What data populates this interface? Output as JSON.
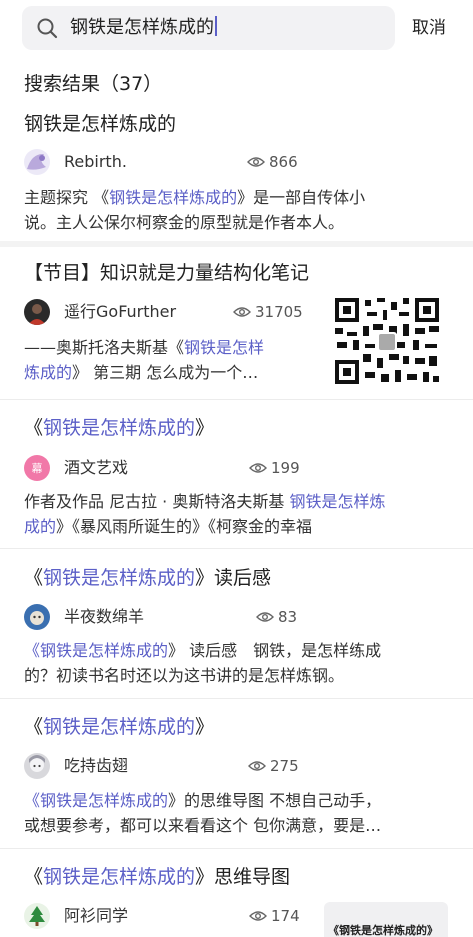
{
  "search": {
    "query": "钢铁是怎样炼成的",
    "cancel_label": "取消"
  },
  "results_heading": "搜索结果（37）",
  "results": [
    {
      "title_hl": "钢铁是怎样炼成的",
      "author": "Rebirth.",
      "views": "866",
      "snippet_line1_pre": "主题探究 《",
      "snippet_line1_hl": "钢铁是怎样炼成的",
      "snippet_line1_post": "》是一部自传体小",
      "snippet_line2": "说。主人公保尔柯察金的原型就是作者本人。"
    },
    {
      "title": "【节目】知识就是力量结构化笔记",
      "author": "遥行GoFurther",
      "views": "31705",
      "snippet_line1_pre": "——奥斯托洛夫斯基《",
      "snippet_line1_hl": "钢铁是怎样",
      "snippet_line2_hl": "炼成的",
      "snippet_line2_post": "》 第三期 怎么成为一个…"
    },
    {
      "title_open": "《",
      "title_hl": "钢铁是怎样炼成的",
      "title_close": "》",
      "author": "酒文艺戏",
      "avatar_text": "幕",
      "views": "199",
      "snippet_line1_pre": "作者及作品 尼古拉 · 奥斯特洛夫斯基 ",
      "snippet_line1_hl": "钢铁是怎样炼",
      "snippet_line2_hl": "成的",
      "snippet_line2_post": "》《暴风雨所诞生的》《柯察金的幸福"
    },
    {
      "title_open": "《",
      "title_hl": "钢铁是怎样炼成的",
      "title_close": "》读后感",
      "author": "半夜数绵羊",
      "views": "83",
      "snippet_line1_open": "《",
      "snippet_line1_hl": "钢铁是怎样炼成的",
      "snippet_line1_post": "》 读后感　钢铁，是怎样练成",
      "snippet_line2": "的？初读书名时还以为这书讲的是怎样炼钢。"
    },
    {
      "title_open": "《",
      "title_hl": "钢铁是怎样炼成的",
      "title_close": "》",
      "author": "吃持齿翅",
      "views": "275",
      "snippet_line1_open": "《",
      "snippet_line1_hl": "钢铁是怎样炼成的",
      "snippet_line1_post": "》的思维导图 不想自己动手，",
      "snippet_line2": "或想要参考，都可以来看看这个 包你满意，要是…"
    },
    {
      "title_open": "《",
      "title_hl": "钢铁是怎样炼成的",
      "title_close": "》思维导图",
      "author": "阿衫同学",
      "views": "174",
      "thumb_text": "《钢铁是怎样炼成的》"
    }
  ]
}
